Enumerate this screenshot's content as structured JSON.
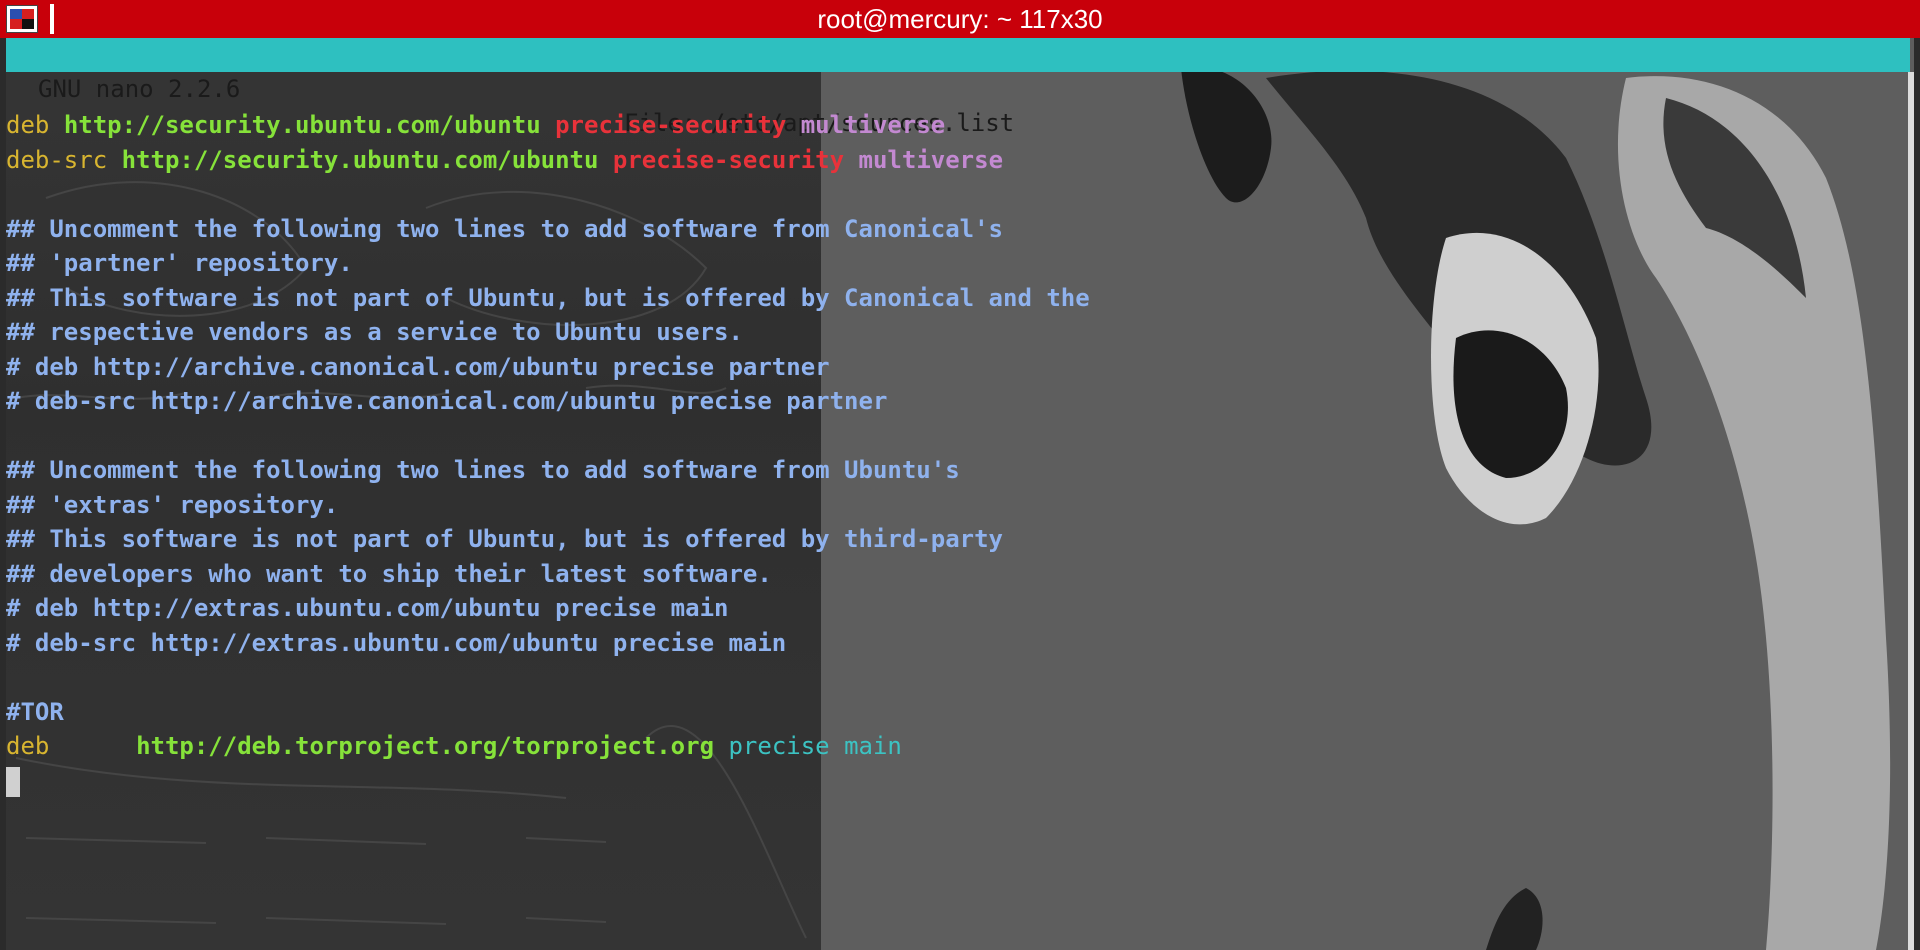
{
  "window": {
    "title": "root@mercury: ~ 117x30",
    "titlebar_color": "#c8000a"
  },
  "nano": {
    "version_label": "GNU nano 2.2.6",
    "file_label": "File: /etc/apt/sources.list",
    "header_color": "#2ec0c0"
  },
  "lines": [
    {
      "type": "deb",
      "keyword": "deb",
      "url": "http://security.ubuntu.com/ubuntu",
      "suite": "precise-security",
      "component": "multiverse"
    },
    {
      "type": "deb",
      "keyword": "deb-src",
      "url": "http://security.ubuntu.com/ubuntu",
      "suite": "precise-security",
      "component": "multiverse"
    },
    {
      "type": "blank"
    },
    {
      "type": "comment",
      "text": "## Uncomment the following two lines to add software from Canonical's"
    },
    {
      "type": "comment",
      "text": "## 'partner' repository."
    },
    {
      "type": "comment",
      "text": "## This software is not part of Ubuntu, but is offered by Canonical and the"
    },
    {
      "type": "comment",
      "text": "## respective vendors as a service to Ubuntu users."
    },
    {
      "type": "comment",
      "text": "# deb http://archive.canonical.com/ubuntu precise partner"
    },
    {
      "type": "comment",
      "text": "# deb-src http://archive.canonical.com/ubuntu precise partner"
    },
    {
      "type": "blank"
    },
    {
      "type": "comment",
      "text": "## Uncomment the following two lines to add software from Ubuntu's"
    },
    {
      "type": "comment",
      "text": "## 'extras' repository."
    },
    {
      "type": "comment",
      "text": "## This software is not part of Ubuntu, but is offered by third-party"
    },
    {
      "type": "comment",
      "text": "## developers who want to ship their latest software."
    },
    {
      "type": "comment",
      "text": "# deb http://extras.ubuntu.com/ubuntu precise main"
    },
    {
      "type": "comment",
      "text": "# deb-src http://extras.ubuntu.com/ubuntu precise main"
    },
    {
      "type": "blank"
    },
    {
      "type": "comment",
      "text": "#TOR"
    },
    {
      "type": "tor",
      "keyword": "deb",
      "gap": "     ",
      "url": "http://deb.torproject.org/torproject.org",
      "suite": "precise main"
    },
    {
      "type": "cursor"
    }
  ],
  "syntax_colors": {
    "keyword": "#d8b530",
    "url": "#86e23a",
    "suite": "#e8323a",
    "component": "#c389d1",
    "comment": "#8fb2ee",
    "tor_suite": "#3cc3c3"
  },
  "icons": {
    "app": "terminal-app-icon"
  }
}
